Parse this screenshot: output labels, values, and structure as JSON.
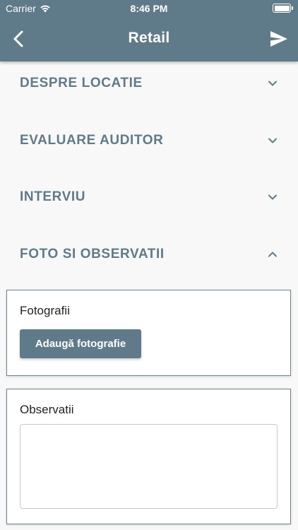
{
  "status_bar": {
    "carrier": "Carrier",
    "time": "8:46 PM"
  },
  "nav": {
    "title": "Retail",
    "back_icon": "chevron-left-icon",
    "send_icon": "send-icon"
  },
  "sections": [
    {
      "label": "DESPRE LOCATIE",
      "expanded": false
    },
    {
      "label": "EVALUARE AUDITOR",
      "expanded": false
    },
    {
      "label": "INTERVIU",
      "expanded": false
    },
    {
      "label": "FOTO SI OBSERVATII",
      "expanded": true
    }
  ],
  "photos": {
    "label": "Fotografii",
    "add_button_label": "Adaugă fotografie"
  },
  "observations": {
    "label": "Observatii",
    "value": ""
  },
  "colors": {
    "primary": "#5f7a88",
    "background": "#f8f8f8"
  }
}
